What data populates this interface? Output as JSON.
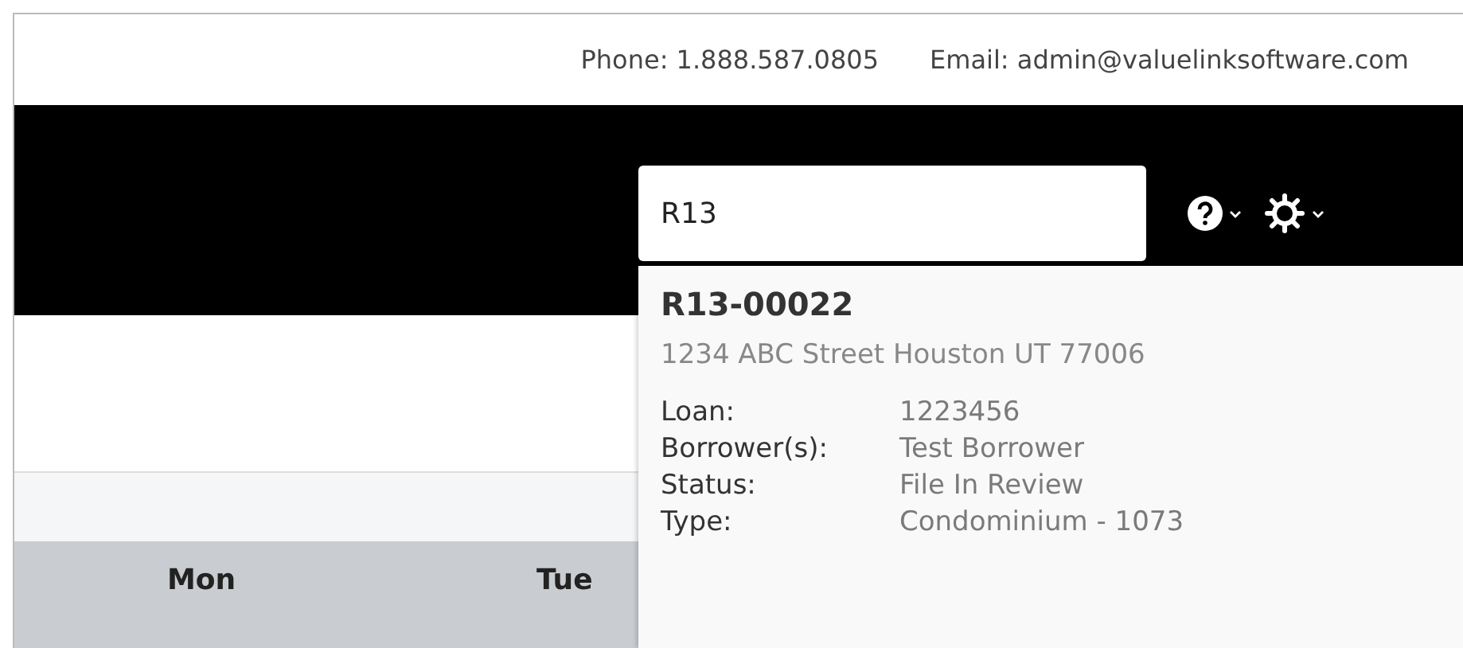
{
  "contact": {
    "phone": "Phone: 1.888.587.0805",
    "email": "Email: admin@valuelinksoftware.com"
  },
  "search": {
    "value": "R13"
  },
  "calendar": {
    "days": [
      "Mon",
      "Tue"
    ]
  },
  "result": {
    "id": "R13-00022",
    "address": "1234 ABC Street Houston UT 77006",
    "fields": [
      {
        "label": "Loan:",
        "value": "1223456"
      },
      {
        "label": "Borrower(s):",
        "value": "Test Borrower"
      },
      {
        "label": "Status:",
        "value": "File In Review"
      },
      {
        "label": "Type:",
        "value": "Condominium - 1073"
      }
    ]
  }
}
